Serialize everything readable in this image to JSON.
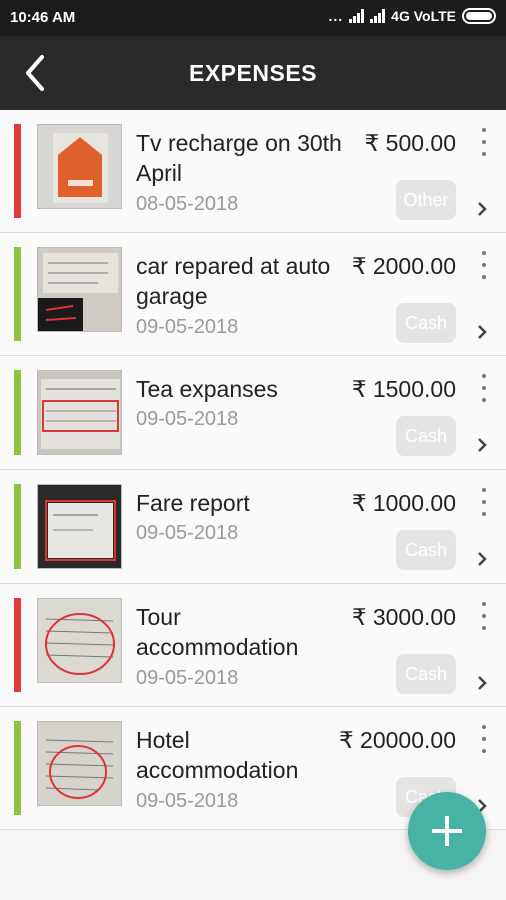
{
  "status_bar": {
    "time": "10:46 AM",
    "dots": "...",
    "network": "4G VoLTE"
  },
  "header": {
    "title": "EXPENSES",
    "back_icon": "back-arrow-icon"
  },
  "colors": {
    "header_bg": "#2a2a2a",
    "status_red": "#e23a3a",
    "status_green": "#8cc63f",
    "fab": "#46b3a4",
    "badge_bg": "#e4e4e4"
  },
  "expenses": [
    {
      "title": "Tv recharge on 30th April",
      "amount": "₹ 500.00",
      "date": "08-05-2018",
      "mode": "Other",
      "status_color": "red"
    },
    {
      "title": "car repared at auto garage",
      "amount": "₹ 2000.00",
      "date": "09-05-2018",
      "mode": "Cash",
      "status_color": "green"
    },
    {
      "title": "Tea expanses",
      "amount": "₹ 1500.00",
      "date": "09-05-2018",
      "mode": "Cash",
      "status_color": "green"
    },
    {
      "title": "Fare report",
      "amount": "₹ 1000.00",
      "date": "09-05-2018",
      "mode": "Cash",
      "status_color": "green"
    },
    {
      "title": "Tour accommodation",
      "amount": "₹ 3000.00",
      "date": "09-05-2018",
      "mode": "Cash",
      "status_color": "red"
    },
    {
      "title": "Hotel accommodation",
      "amount": "₹ 20000.00",
      "date": "09-05-2018",
      "mode": "Cash",
      "status_color": "green"
    }
  ],
  "fab": {
    "icon": "plus-icon"
  }
}
